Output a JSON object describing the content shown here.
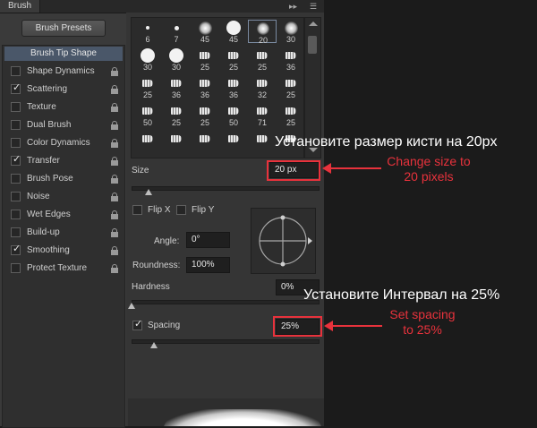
{
  "panel": {
    "tab_title": "Brush",
    "presets_button": "Brush Presets",
    "tip_shape_label": "Brush Tip Shape",
    "options": [
      {
        "label": "Shape Dynamics",
        "checked": false
      },
      {
        "label": "Scattering",
        "checked": true
      },
      {
        "label": "Texture",
        "checked": false
      },
      {
        "label": "Dual Brush",
        "checked": false
      },
      {
        "label": "Color Dynamics",
        "checked": false
      },
      {
        "label": "Transfer",
        "checked": true
      },
      {
        "label": "Brush Pose",
        "checked": false
      },
      {
        "label": "Noise",
        "checked": false
      },
      {
        "label": "Wet Edges",
        "checked": false
      },
      {
        "label": "Build-up",
        "checked": false
      },
      {
        "label": "Smoothing",
        "checked": true
      },
      {
        "label": "Protect Texture",
        "checked": false
      }
    ]
  },
  "tips": [
    [
      "6",
      "7",
      "45",
      "45",
      "20",
      "30"
    ],
    [
      "30",
      "30",
      "25",
      "25",
      "25",
      "36"
    ],
    [
      "25",
      "36",
      "36",
      "36",
      "32",
      "25"
    ],
    [
      "50",
      "25",
      "25",
      "50",
      "71",
      "25"
    ],
    [
      "",
      "",
      "",
      "",
      "",
      ""
    ]
  ],
  "selected_tip": "20",
  "controls": {
    "size_label": "Size",
    "size_value": "20 px",
    "size_slider_fraction": 0.09,
    "flip_x_label": "Flip X",
    "flip_y_label": "Flip Y",
    "angle_label": "Angle:",
    "angle_value": "0°",
    "roundness_label": "Roundness:",
    "roundness_value": "100%",
    "hardness_label": "Hardness",
    "hardness_value": "0%",
    "spacing_label": "Spacing",
    "spacing_checked": true,
    "spacing_value": "25%",
    "spacing_slider_fraction": 0.12
  },
  "annotations": {
    "size_ru": "Установите размер кисти на 20px",
    "size_en_line1": "Change size to",
    "size_en_line2": "20 pixels",
    "spacing_ru": "Установите Интервал на 25%",
    "spacing_en_line1": "Set spacing",
    "spacing_en_line2": "to 25%"
  },
  "colors": {
    "annotation_red": "#e8323c",
    "selection_blue": "#4a5769"
  }
}
